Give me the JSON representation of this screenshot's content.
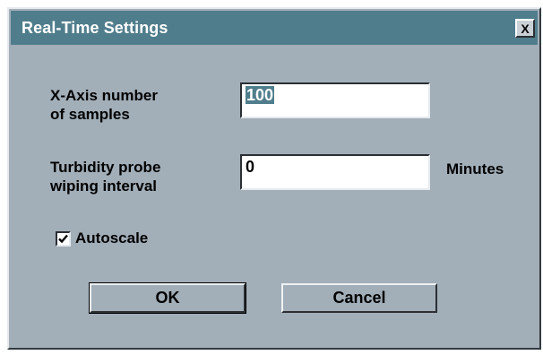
{
  "window": {
    "title": "Real-Time Settings",
    "close_glyph": "X"
  },
  "fields": {
    "x_axis": {
      "label_line1": "X-Axis number",
      "label_line2": "of samples",
      "value": "100"
    },
    "turbidity": {
      "label_line1": "Turbidity probe",
      "label_line2": "wiping interval",
      "value": "0",
      "unit": "Minutes"
    }
  },
  "autoscale": {
    "label": "Autoscale",
    "checked": true
  },
  "buttons": {
    "ok": "OK",
    "cancel": "Cancel"
  },
  "colors": {
    "titlebar": "#507d8c",
    "dialog_bg": "#a2aeb8",
    "field_bg": "#ffffff"
  },
  "icons": {
    "close": "close-icon",
    "check": "checkmark-icon"
  }
}
